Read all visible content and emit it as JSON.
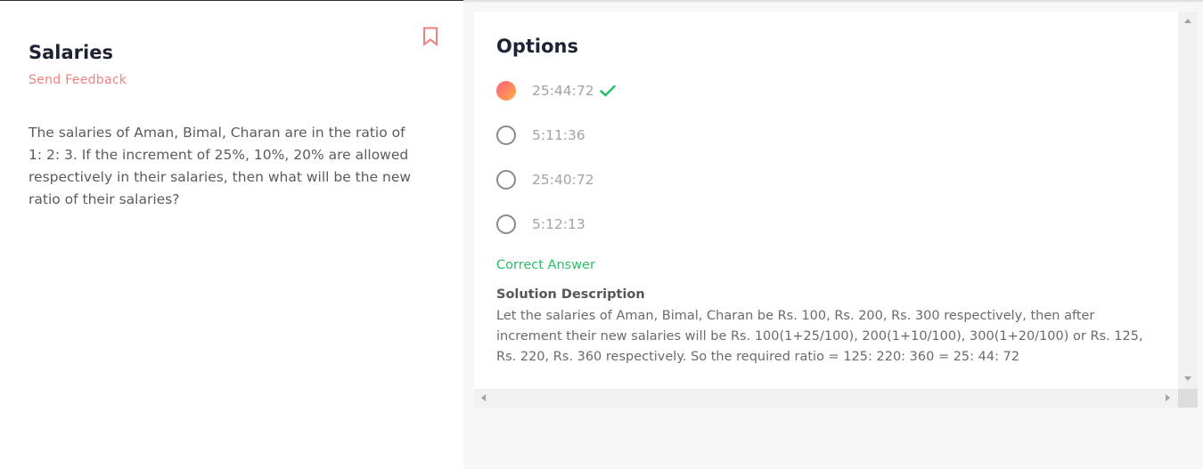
{
  "question": {
    "title": "Salaries",
    "feedback_label": "Send Feedback",
    "text": "The salaries of Aman, Bimal, Charan are in the ratio of 1: 2: 3. If the increment of 25%, 10%, 20% are allowed respectively in their salaries, then what will be the new ratio of their salaries?"
  },
  "options_panel": {
    "title": "Options",
    "options": [
      {
        "label": "25:44:72",
        "selected": true,
        "correct": true
      },
      {
        "label": "5:11:36",
        "selected": false,
        "correct": false
      },
      {
        "label": "25:40:72",
        "selected": false,
        "correct": false
      },
      {
        "label": "5:12:13",
        "selected": false,
        "correct": false
      }
    ],
    "result_label": "Correct Answer",
    "solution_title": "Solution Description",
    "solution_text": "Let the salaries of Aman, Bimal, Charan be Rs. 100, Rs. 200, Rs. 300 respectively, then after increment their new salaries will be Rs. 100(1+25/100), 200(1+10/100), 300(1+20/100) or Rs. 125, Rs. 220, Rs. 360 respectively. So the required ratio = 125: 220: 360 = 25: 44: 72"
  },
  "colors": {
    "accent": "#f0817f",
    "correct": "#2ebd6a",
    "heading": "#1e2235"
  },
  "icons": {
    "bookmark": "bookmark-icon",
    "check": "checkmark-icon"
  }
}
